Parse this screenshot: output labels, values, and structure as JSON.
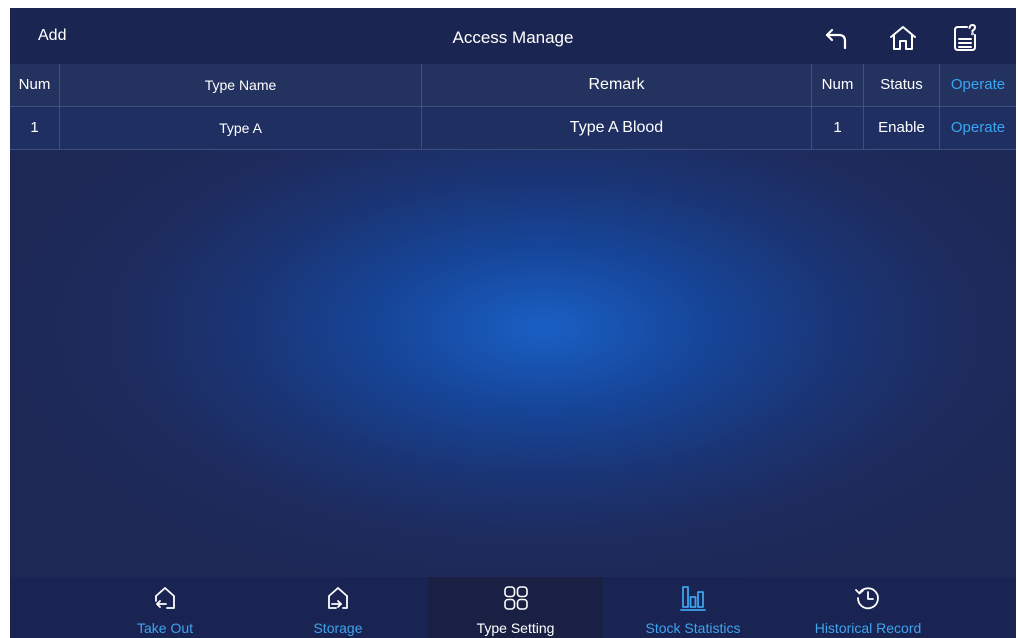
{
  "header": {
    "add_label": "Add",
    "title": "Access Manage",
    "icons": [
      "back-icon",
      "home-icon",
      "help-document-icon"
    ]
  },
  "table": {
    "columns": [
      "Num",
      "Type Name",
      "Remark",
      "Num",
      "Status",
      "Operate"
    ],
    "rows": [
      {
        "num": "1",
        "type_name": "Type A",
        "remark": "Type A Blood",
        "count": "1",
        "status": "Enable",
        "operate": "Operate"
      }
    ]
  },
  "nav": {
    "items": [
      {
        "label": "Take Out",
        "icon": "take-out-icon"
      },
      {
        "label": "Storage",
        "icon": "storage-icon"
      },
      {
        "label": "Type Setting",
        "icon": "type-setting-icon"
      },
      {
        "label": "Stock Statistics",
        "icon": "stock-statistics-icon"
      },
      {
        "label": "Historical Record",
        "icon": "historical-record-icon"
      }
    ],
    "active_label": "Type Setting"
  },
  "colors": {
    "accent": "#3fa3ee",
    "topbar": "#1b2551",
    "active_text": "#ffffff"
  }
}
